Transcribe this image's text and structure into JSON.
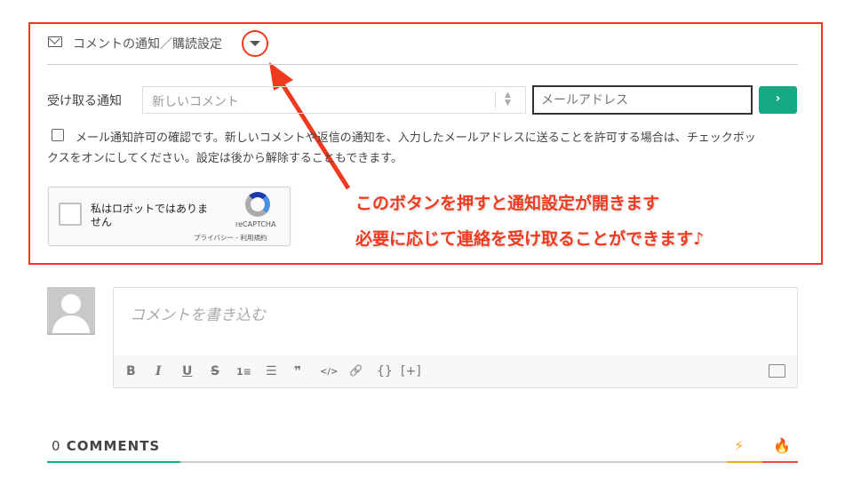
{
  "subscribe": {
    "title": "コメントの通知／購読設定",
    "notify_label": "受け取る通知",
    "notify_select": "新しいコメント",
    "email_placeholder": "メールアドレス",
    "submit_label": "›",
    "consent_text": "メール通知許可の確認です。新しいコメントや返信の通知を、入力したメールアドレスに送ることを許可する場合は、チェックボックスをオンにしてください。設定は後から解除することもできます。"
  },
  "recaptcha": {
    "label": "私はロボットではありません",
    "brand": "reCAPTCHA",
    "links": "プライバシー - 利用規約"
  },
  "annotation": {
    "line1": "このボタンを押すと通知設定が開きます",
    "line2": "必要に応じて連絡を受け取ることができます♪",
    "color": "#ee3a1f"
  },
  "comment": {
    "placeholder": "コメントを書き込む",
    "toolbar": [
      "B",
      "I",
      "U",
      "S",
      "1≡",
      "☰",
      "❞",
      "</>",
      "🔗",
      "{}",
      "[+]"
    ]
  },
  "comments": {
    "count": "0",
    "label": "COMMENTS",
    "accent": "#17a884"
  }
}
